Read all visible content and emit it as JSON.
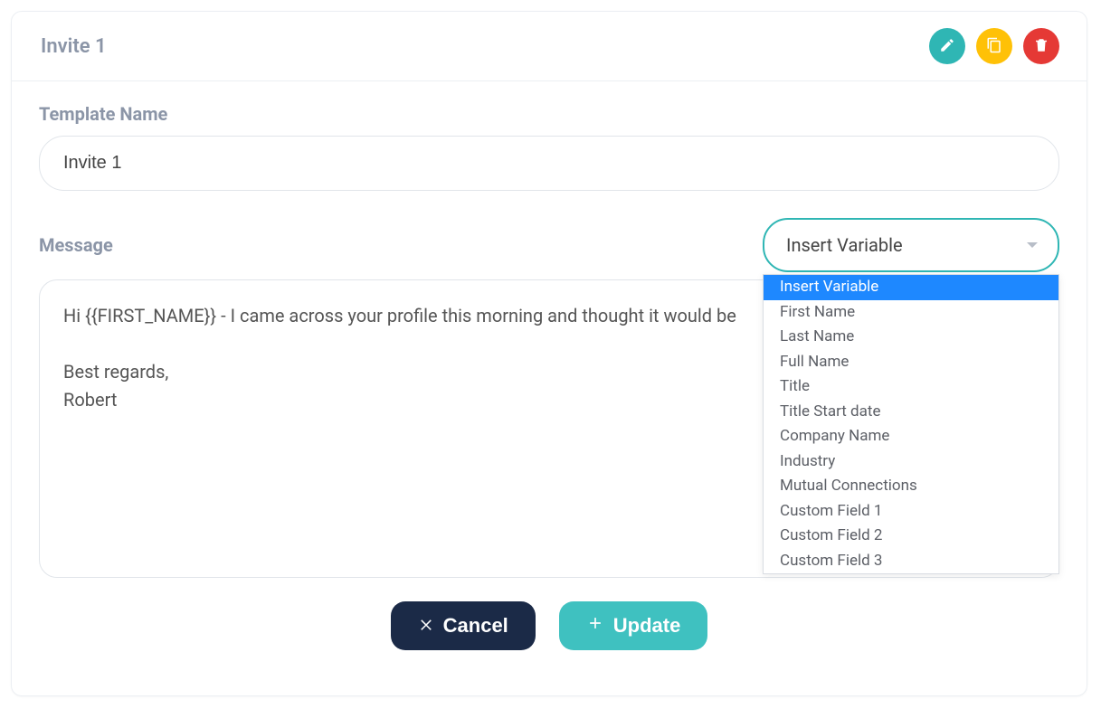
{
  "header": {
    "title": "Invite 1"
  },
  "form": {
    "template_name_label": "Template Name",
    "template_name_value": "Invite 1",
    "message_label": "Message",
    "message_value": "Hi {{FIRST_NAME}} - I came across your profile this morning and thought it would be\n\nBest regards,\nRobert"
  },
  "variable_select": {
    "selected": "Insert Variable",
    "options": [
      "Insert Variable",
      "First Name",
      "Last Name",
      "Full Name",
      "Title",
      "Title Start date",
      "Company Name",
      "Industry",
      "Mutual Connections",
      "Custom Field 1",
      "Custom Field 2",
      "Custom Field 3"
    ]
  },
  "buttons": {
    "cancel": "Cancel",
    "update": "Update"
  }
}
